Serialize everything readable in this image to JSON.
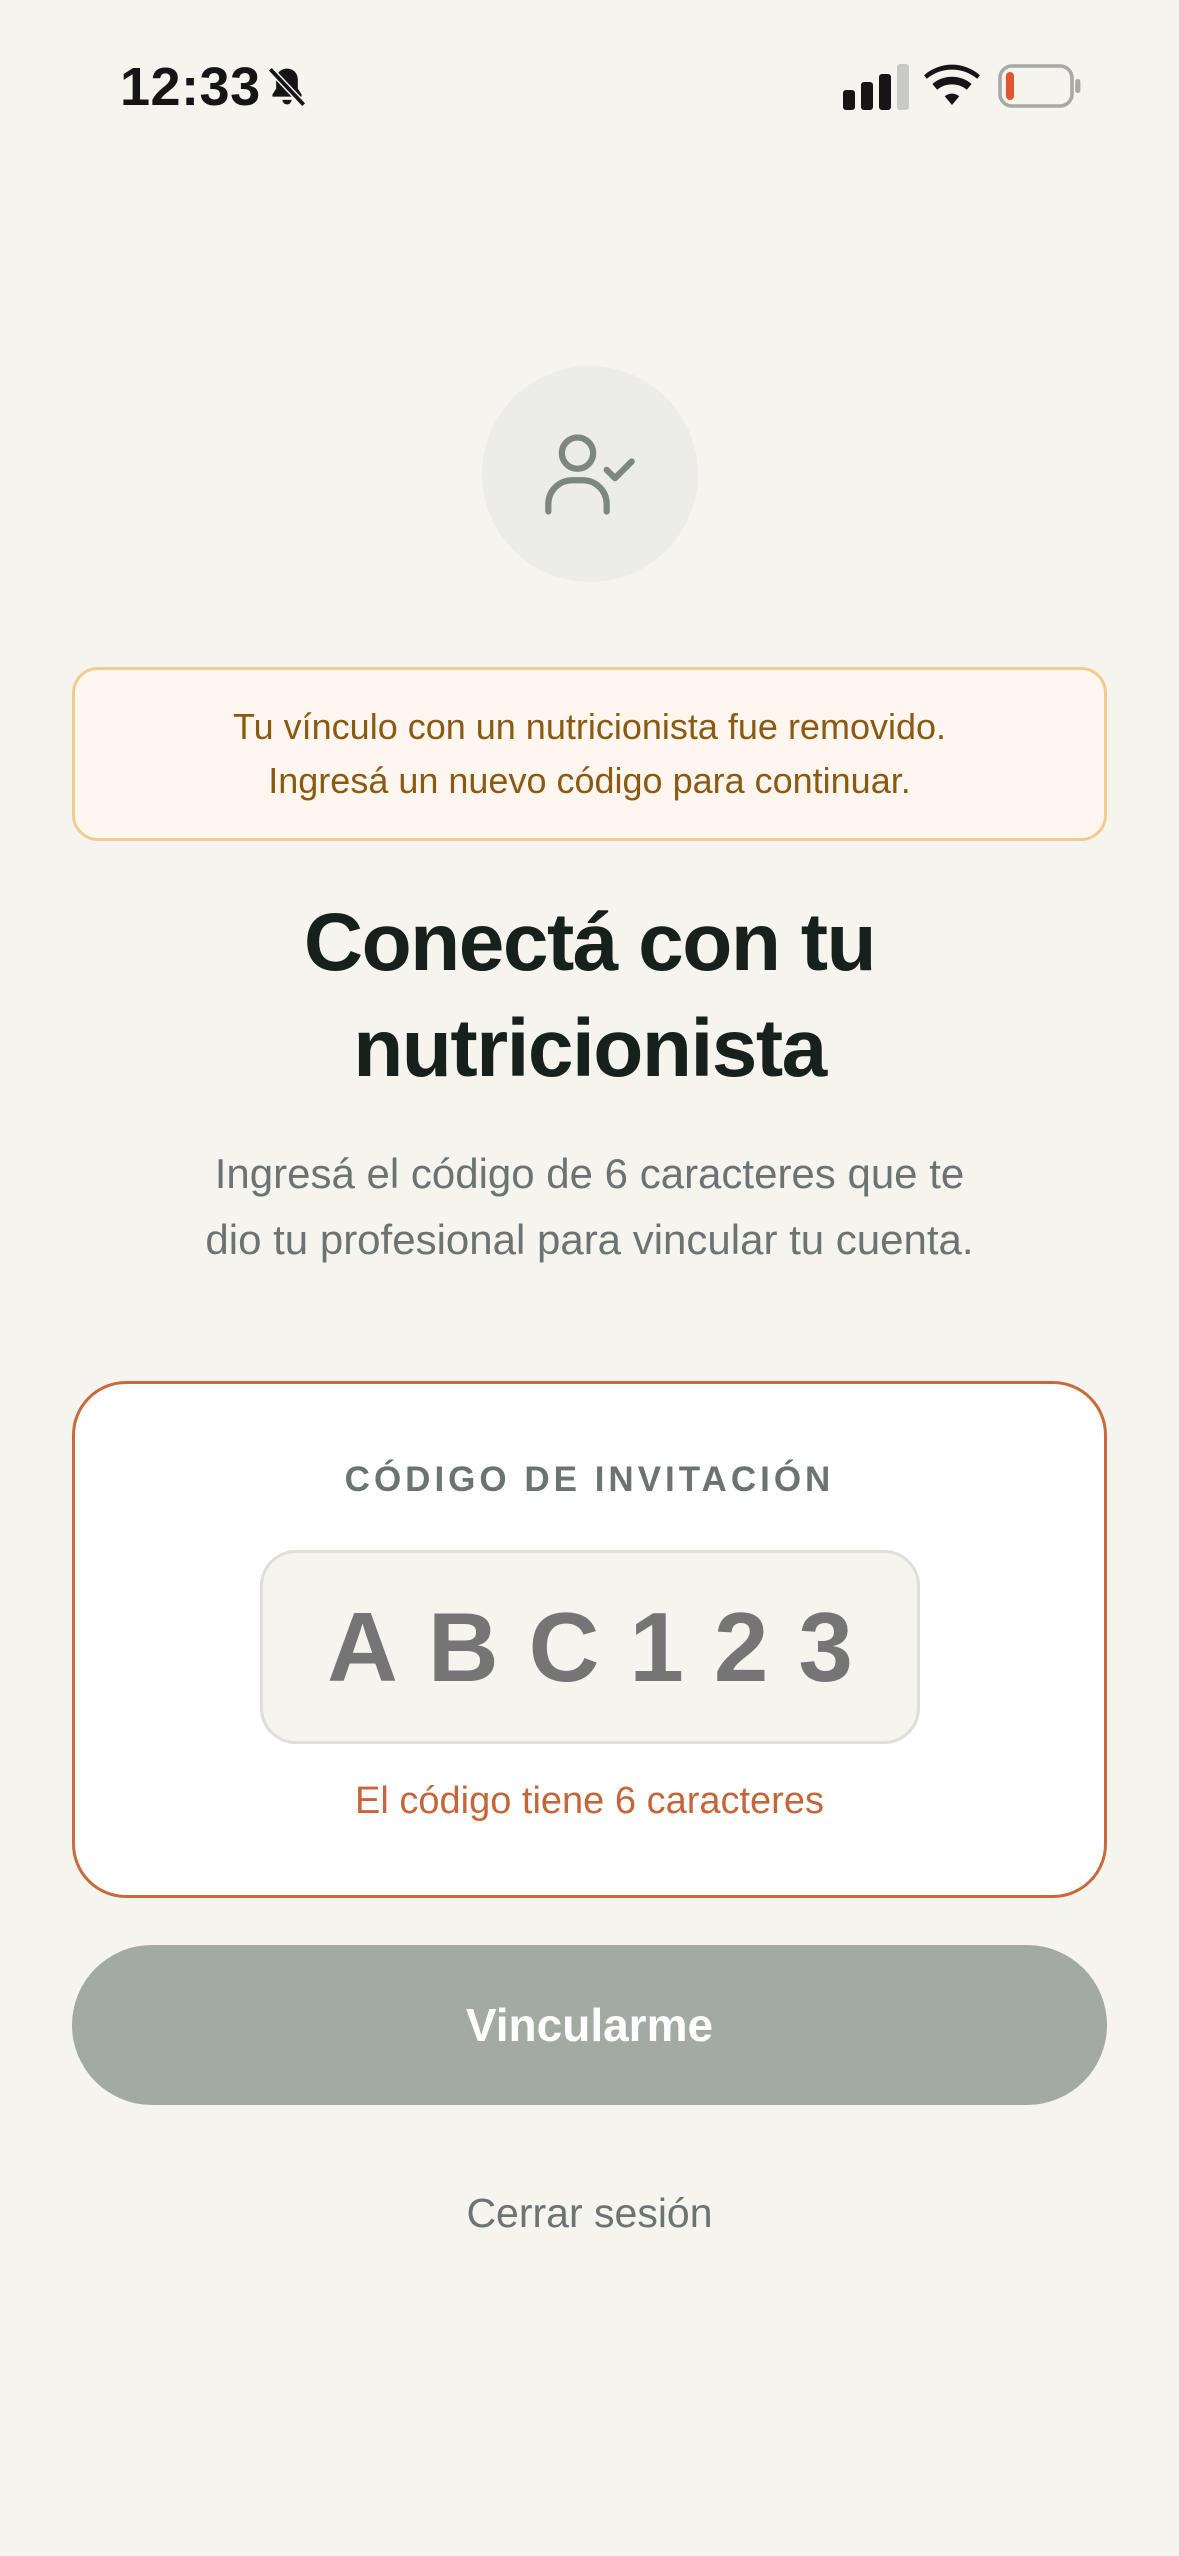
{
  "status_bar": {
    "time": "12:33",
    "battery_level_percent": 10,
    "battery_color": "#e2552f"
  },
  "alert": {
    "line1": "Tu vínculo con un nutricionista fue removido.",
    "line2": "Ingresá un nuevo código para continuar."
  },
  "header": {
    "icon": "user-check-icon",
    "title_line1": "Conectá con tu",
    "title_line2": "nutricionista",
    "subtitle_line1": "Ingresá el código de 6 caracteres que te",
    "subtitle_line2": "dio tu profesional para vincular tu cuenta."
  },
  "code_form": {
    "label": "CÓDIGO DE INVITACIÓN",
    "value": "",
    "placeholder": "ABC123",
    "hint": "El código tiene 6 caracteres"
  },
  "actions": {
    "link_label": "Vincularme",
    "logout_label": "Cerrar sesión"
  },
  "colors": {
    "background": "#f5f4ef",
    "accent": "#c96a3c",
    "button_disabled": "#a2aaa3",
    "alert_bg": "#fff6ef",
    "alert_border": "#f0cd8f"
  }
}
